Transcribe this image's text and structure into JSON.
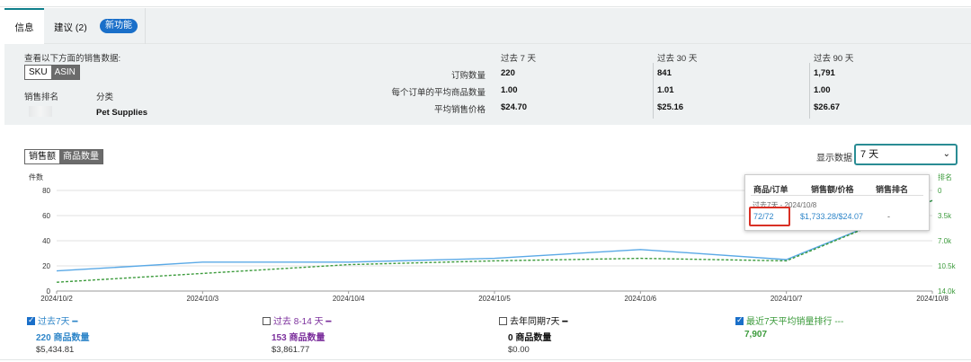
{
  "tabs": {
    "info": "信息",
    "suggestions": "建议 (2)",
    "new_badge": "新功能"
  },
  "summary": {
    "view_by": "查看以下方面的销售数据:",
    "seg": {
      "sku": "SKU",
      "asin": "ASIN"
    },
    "rank_label": "销售排名",
    "category_label": "分类",
    "category_value": "Pet Supplies",
    "row_labels": [
      "订购数量",
      "每个订单的平均商品数量",
      "平均销售价格"
    ],
    "periods": [
      {
        "title": "过去 7 天",
        "values": [
          "220",
          "1.00",
          "$24.70"
        ]
      },
      {
        "title": "过去 30 天",
        "values": [
          "841",
          "1.01",
          "$25.16"
        ]
      },
      {
        "title": "过去 90 天",
        "values": [
          "1,791",
          "1.00",
          "$26.67"
        ]
      }
    ]
  },
  "chart_toggle": {
    "sales": "销售额",
    "units": "商品数量"
  },
  "display_label": "显示数据",
  "display_select": "7 天",
  "chart_data": {
    "type": "line",
    "ylabel_left": "件数",
    "ylabel_right": "排名",
    "x": [
      "2024/10/2",
      "2024/10/3",
      "2024/10/4",
      "2024/10/5",
      "2024/10/6",
      "2024/10/7",
      "2024/10/8"
    ],
    "y_left_ticks": [
      "0",
      "20",
      "40",
      "60",
      "80"
    ],
    "y_right_ticks": [
      "0",
      "3.5k",
      "7.0k",
      "10.5k",
      "14.0k"
    ],
    "ylim_left": [
      0,
      80
    ],
    "series": [
      {
        "name": "过去7天",
        "values": [
          16,
          23,
          23,
          26,
          33,
          25,
          72
        ],
        "color": "#5aa9e6"
      },
      {
        "name": "最近7天平均销量排行",
        "values": [
          7,
          14,
          21,
          24,
          26,
          24,
          72
        ],
        "color": "#3c9b3c"
      }
    ]
  },
  "tooltip": {
    "headers": [
      "商品/订单",
      "销售额/价格",
      "销售排名"
    ],
    "subtitle": "过去7天 - 2024/10/8",
    "values": [
      "72/72",
      "$1,733.28/$24.07",
      "-"
    ]
  },
  "legend": [
    {
      "label": "过去7天 ━",
      "count": "220 商品数量",
      "amount": "$5,434.81",
      "checked": true,
      "color": "#2f86c9"
    },
    {
      "label": "过去 8-14 天 ━",
      "count": "153 商品数量",
      "amount": "$3,861.77",
      "checked": false,
      "color": "#7b2f9c"
    },
    {
      "label": "去年同期7天 ━",
      "count": "0 商品数量",
      "amount": "$0.00",
      "checked": false,
      "color": "#111111"
    },
    {
      "label": "最近7天平均销量排行 ---",
      "count": "7,907",
      "amount": "",
      "checked": true,
      "color": "#3c9b3c"
    }
  ]
}
